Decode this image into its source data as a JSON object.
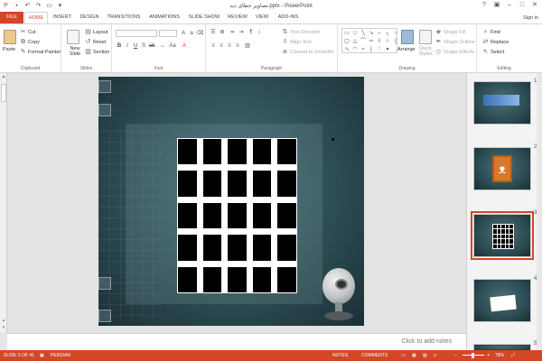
{
  "titlebar": {
    "title": "تصاویر خطای دید.pptx - PowerPoint",
    "qat_icons": [
      "save-icon",
      "undo-icon",
      "redo-icon",
      "start-slideshow-icon",
      "customize-qat-icon"
    ],
    "window_controls": {
      "help": "?",
      "ribbon_options": "▣",
      "minimize": "–",
      "maximize": "□",
      "close": "✕"
    }
  },
  "tabs": {
    "file": "FILE",
    "home": "HOME",
    "insert": "INSERT",
    "design": "DESIGN",
    "transitions": "TRANSITIONS",
    "animations": "ANIMATIONS",
    "slideshow": "SLIDE SHOW",
    "review": "REVIEW",
    "view": "VIEW",
    "addins": "ADD-INS",
    "signin": "Sign in"
  },
  "ribbon": {
    "clipboard": {
      "paste": "Paste",
      "cut": "Cut",
      "copy": "Copy",
      "format_painter": "Format Painter",
      "label": "Clipboard"
    },
    "slides": {
      "new_slide": "New Slide",
      "layout": "Layout",
      "reset": "Reset",
      "section": "Section",
      "label": "Slides"
    },
    "font": {
      "label": "Font"
    },
    "paragraph": {
      "text_direction": "Text Direction",
      "align_text": "Align Text",
      "convert_smartart": "Convert to SmartArt",
      "label": "Paragraph"
    },
    "drawing": {
      "arrange": "Arrange",
      "quick_styles": "Quick Styles",
      "shape_fill": "Shape Fill",
      "shape_outline": "Shape Outline",
      "shape_effects": "Shape Effects",
      "label": "Drawing"
    },
    "editing": {
      "find": "Find",
      "replace": "Replace",
      "select": "Select",
      "label": "Editing"
    }
  },
  "notes": {
    "placeholder": "Click to add notes"
  },
  "thumbnails": [
    "1",
    "2",
    "3",
    "4",
    "5"
  ],
  "status": {
    "slide_info": "SLIDE 3 OF 41",
    "language": "PERSIAN",
    "notes": "NOTES",
    "comments": "COMMENTS",
    "zoom": "78%"
  },
  "colors": {
    "accent": "#d24726",
    "slide_bg": "#2d4d54"
  }
}
